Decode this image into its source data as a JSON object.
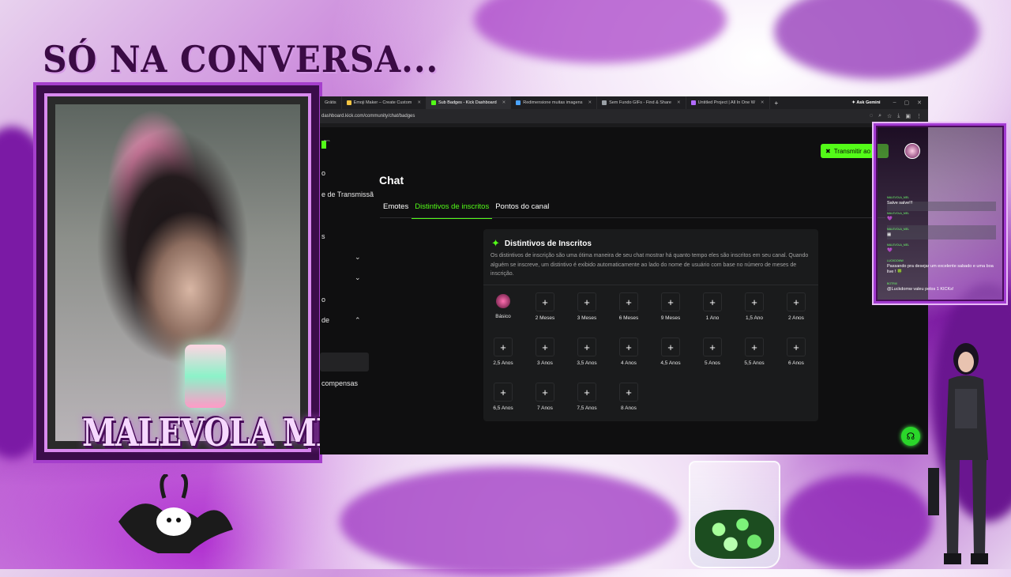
{
  "overlay": {
    "title": "SÓ NA CONVERSA...",
    "brand": "MALEVOLA MEL"
  },
  "browser": {
    "tabs": [
      {
        "label": "Grátis",
        "color": "#c8c8c8"
      },
      {
        "label": "Emoji Maker – Create Custom",
        "color": "#f5c542"
      },
      {
        "label": "Sub Badges - Kick Dashboard",
        "color": "#53fc18",
        "active": true
      },
      {
        "label": "Redimensione muitas imagens",
        "color": "#4aa3ff"
      },
      {
        "label": "Sem Fundo GIFs - Find & Share",
        "color": "#9aa0a6"
      },
      {
        "label": "Untitled Project | All In One W",
        "color": "#b26bff"
      }
    ],
    "new_tab": "+",
    "ask_gemini": "Ask Gemini",
    "url": "dashboard.kick.com/community/chat/badges"
  },
  "sidebar": {
    "beta": "BETA",
    "items": [
      "o",
      "e de Transmissã",
      "s",
      "",
      "",
      "o",
      "de",
      "compensas"
    ]
  },
  "header": {
    "transmit_button": "Transmitir ao"
  },
  "page": {
    "title": "Chat",
    "tabs": [
      "Emotes",
      "Distintivos de inscritos",
      "Pontos do canal"
    ],
    "active_tab": "Distintivos de inscritos"
  },
  "card": {
    "title": "Distintivos de Inscritos",
    "description": "Os distintivos de inscrição são uma ótima maneira de seu chat mostrar há quanto tempo eles são inscritos em seu canal. Quando alguém se inscreve, um distintivo é exibido automaticamente ao lado do nome de usuário com base no número de meses de inscrição.",
    "badges": [
      "Básico",
      "2 Meses",
      "3 Meses",
      "6 Meses",
      "9 Meses",
      "1 Ano",
      "1,5 Ano",
      "2 Anos",
      "2,5 Anos",
      "3 Anos",
      "3,5 Anos",
      "4 Anos",
      "4,5 Anos",
      "5 Anos",
      "5,5 Anos",
      "6 Anos",
      "6,5 Anos",
      "7 Anos",
      "7,5 Anos",
      "8 Anos"
    ],
    "add_symbol": "+"
  },
  "chat": {
    "messages": [
      {
        "user": "MALEVOLA_MEL",
        "text": "Salve salve!!!"
      },
      {
        "user": "MALEVOLA_MEL",
        "text": "💜"
      },
      {
        "user": "MALEVOLA_MEL",
        "text": "▦"
      },
      {
        "user": "MALEVOLA_MEL",
        "text": "💜"
      },
      {
        "user": "LUCKDOMW",
        "text": "Passando pra desejar um excelente sabado e uma boa live ! 🍀"
      },
      {
        "user": "BOTRIX",
        "text": "@Luckdomw valeu pelos 1 KICKs!"
      }
    ]
  },
  "colors": {
    "kick_green": "#53fc18",
    "frame_purple": "#a23bd1"
  }
}
